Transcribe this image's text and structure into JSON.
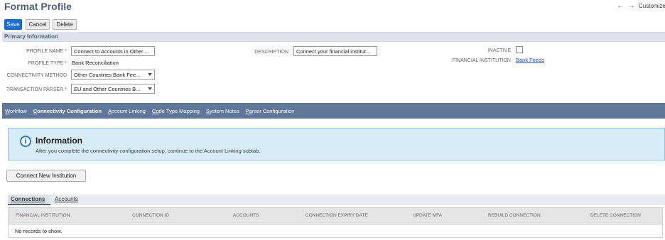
{
  "page": {
    "title": "Format Profile",
    "customize_label": "Customize"
  },
  "toolbar": {
    "save_label": "Save",
    "cancel_label": "Cancel",
    "delete_label": "Delete"
  },
  "section": {
    "title": "Primary Information"
  },
  "form": {
    "profile_name": {
      "label": "PROFILE NAME",
      "value": "Connect to Accounts in Other ..."
    },
    "profile_type": {
      "label": "PROFILE TYPE",
      "value": "Bank Reconciliation"
    },
    "connectivity_method": {
      "label": "CONNECTIVITY METHOD",
      "value": "Other Countries Bank Fee..."
    },
    "transaction_parser": {
      "label": "TRANSACTION PARSER",
      "value": "EU and Other Countries B..."
    },
    "description": {
      "label": "DESCRIPTION",
      "value": "Connect your financial institut..."
    },
    "inactive": {
      "label": "INACTIVE",
      "checked": false
    },
    "financial_institution": {
      "label": "FINANCIAL INSTITUTION",
      "value": "Bank Feeds"
    }
  },
  "tabs": [
    {
      "label": "Workflow",
      "underline": "W",
      "rest": "orkflow"
    },
    {
      "label": "Connectivity Configuration",
      "underline": "C",
      "rest": "onnectivity Configuration"
    },
    {
      "label": "Account Linking",
      "underline": "A",
      "rest": "ccount Linking"
    },
    {
      "label": "Code Type Mapping",
      "underline": "Co",
      "rest": "de Type Mapping"
    },
    {
      "label": "System Notes",
      "underline": "S",
      "rest": "ystem Notes"
    },
    {
      "label": "Parser Configuration",
      "underline": "Pa",
      "rest": "rser Configuration"
    }
  ],
  "info": {
    "title": "Information",
    "text": "After you complete the connectivity configuration setup, continue to the Account Linking subtab."
  },
  "connect_button": {
    "label": "Connect New Institution"
  },
  "subtabs": [
    {
      "label": "Connections"
    },
    {
      "label": "Accounts"
    }
  ],
  "table": {
    "columns": [
      "FINANCIAL INSTITUTION",
      "CONNECTION ID",
      "ACCOUNTS",
      "CONNECTION EXPIRY DATE",
      "UPDATE MFA",
      "REBUILD CONNECTION",
      "DELETE CONNECTION"
    ],
    "empty_text": "No records to show."
  },
  "colors": {
    "accent": "#1a6ed8",
    "tabbar": "#607799",
    "info_bg": "#d6ecf8",
    "title": "#4d5f79"
  },
  "icons": {
    "back": "arrow-left-icon",
    "forward": "arrow-right-icon",
    "info": "info-circle-icon"
  }
}
